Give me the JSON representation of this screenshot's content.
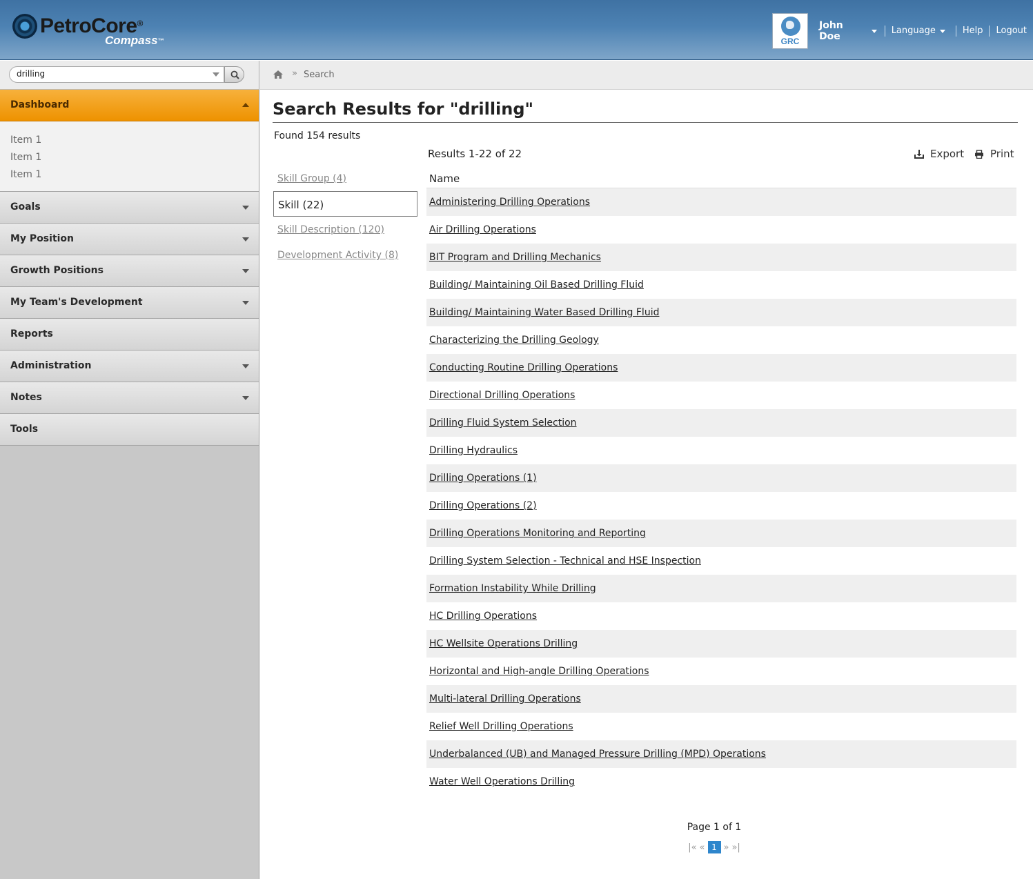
{
  "header": {
    "brand": "PetroCore",
    "brand_reg": "®",
    "brand_sub": "Compass",
    "brand_tm": "™",
    "badge": "GRC",
    "user_name": "John Doe",
    "language": "Language",
    "help": "Help",
    "logout": "Logout"
  },
  "search": {
    "value": "drilling"
  },
  "sidebar": {
    "dashboard": {
      "label": "Dashboard",
      "items": [
        "Item 1",
        "Item 1",
        "Item 1"
      ]
    },
    "items": [
      {
        "label": "Goals",
        "has_arrow": true
      },
      {
        "label": "My Position",
        "has_arrow": true
      },
      {
        "label": "Growth Positions",
        "has_arrow": true
      },
      {
        "label": "My Team's Development",
        "has_arrow": true
      },
      {
        "label": "Reports",
        "has_arrow": false
      },
      {
        "label": "Administration",
        "has_arrow": true
      },
      {
        "label": "Notes",
        "has_arrow": true
      },
      {
        "label": "Tools",
        "has_arrow": false
      }
    ]
  },
  "breadcrumb": {
    "separator": "»",
    "current": "Search"
  },
  "main": {
    "title": "Search Results for \"drilling\"",
    "found": "Found 154 results",
    "results_range": "Results 1-22 of 22",
    "export": "Export",
    "print": "Print",
    "column_name": "Name",
    "facets": [
      {
        "label": "Skill Group (4)",
        "selected": false
      },
      {
        "label": "Skill (22)",
        "selected": true
      },
      {
        "label": "Skill Description (120)",
        "selected": false
      },
      {
        "label": "Development Activity (8)",
        "selected": false
      }
    ],
    "results": [
      "Administering Drilling Operations",
      "Air Drilling Operations",
      "BIT Program and Drilling Mechanics",
      "Building/ Maintaining Oil Based Drilling Fluid",
      "Building/ Maintaining Water Based Drilling Fluid",
      "Characterizing the Drilling Geology",
      "Conducting Routine Drilling Operations",
      "Directional Drilling Operations",
      "Drilling Fluid System Selection",
      "Drilling Hydraulics",
      "Drilling Operations (1)",
      "Drilling Operations (2)",
      "Drilling Operations Monitoring and Reporting",
      "Drilling System Selection - Technical and HSE Inspection",
      "Formation Instability While Drilling",
      "HC Drilling Operations",
      "HC Wellsite Operations Drilling",
      "Horizontal and High-angle Drilling Operations",
      "Multi-lateral Drilling Operations",
      "Relief Well Drilling Operations",
      "Underbalanced (UB) and Managed Pressure Drilling (MPD) Operations",
      "Water Well Operations Drilling"
    ],
    "pager": {
      "text": "Page 1 of 1",
      "first": "|«",
      "prev": "«",
      "current": "1",
      "next": "»",
      "last": "»|"
    }
  },
  "colors": {
    "accent": "#ee9200",
    "header": "#4d82b3",
    "page_link": "#2e86cc"
  },
  "icons": [
    "search-icon",
    "home-icon",
    "export-icon",
    "print-icon",
    "chevron-down-icon",
    "globe-icon"
  ]
}
